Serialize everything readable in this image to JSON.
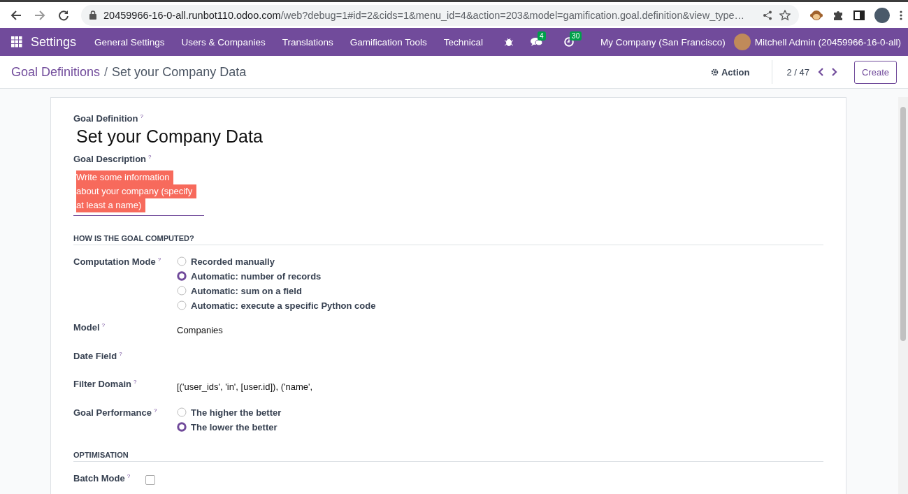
{
  "browser": {
    "url_host": "20459966-16-0-all.runbot110.odoo.com",
    "url_path": "/web?debug=1#id=2&cids=1&menu_id=4&action=203&model=gamification.goal.definition&view_type…"
  },
  "navbar": {
    "app_name": "Settings",
    "menu": [
      "General Settings",
      "Users & Companies",
      "Translations",
      "Gamification Tools",
      "Technical"
    ],
    "messages_badge": "4",
    "activities_badge": "30",
    "company": "My Company (San Francisco)",
    "user": "Mitchell Admin (20459966-16-0-all)"
  },
  "control_panel": {
    "breadcrumb_parent": "Goal Definitions",
    "breadcrumb_separator": "/",
    "breadcrumb_current": "Set your Company Data",
    "action": "Action",
    "pager": "2 / 47",
    "create": "Create"
  },
  "form": {
    "name_label": "Goal Definition",
    "help_mark": "?",
    "name": "Set your Company Data",
    "description_label": "Goal Description",
    "description_lines": [
      "Write some information",
      "about your company (specify",
      "at least a name)"
    ],
    "sections": [
      {
        "title": "HOW IS THE GOAL COMPUTED?",
        "fields": [
          {
            "kind": "radio",
            "label": "Computation Mode",
            "options": [
              {
                "label": "Recorded manually",
                "selected": false
              },
              {
                "label": "Automatic: number of records",
                "selected": true
              },
              {
                "label": "Automatic: sum on a field",
                "selected": false
              },
              {
                "label": "Automatic: execute a specific Python code",
                "selected": false
              }
            ]
          },
          {
            "kind": "text",
            "label": "Model",
            "value": "Companies"
          },
          {
            "kind": "text",
            "label": "Date Field"
          },
          {
            "kind": "text",
            "label": "Filter Domain",
            "value": "[('user_ids', 'in', [user.id]), ('name',"
          },
          {
            "kind": "radio",
            "label": "Goal Performance",
            "options": [
              {
                "label": "The higher the better",
                "selected": false
              },
              {
                "label": "The lower the better",
                "selected": true
              }
            ]
          }
        ]
      },
      {
        "title": "OPTIMISATION",
        "fields": [
          {
            "kind": "checkbox",
            "label": "Batch Mode",
            "checked": false
          }
        ]
      }
    ]
  }
}
